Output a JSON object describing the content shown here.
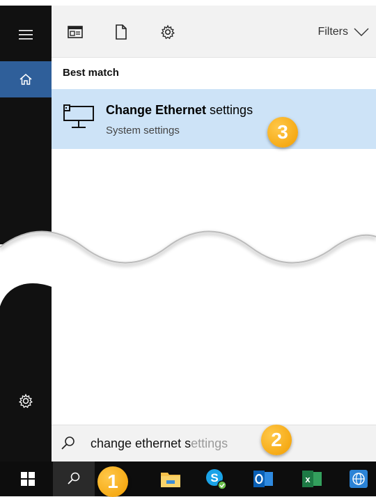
{
  "toolbar": {
    "filters_label": "Filters"
  },
  "results": {
    "section_title": "Best match",
    "best_match": {
      "title_bold": "Change Ethernet",
      "title_rest": " settings",
      "subtitle": "System settings"
    }
  },
  "search": {
    "typed": "change ethernet s",
    "suggestion": "ettings"
  },
  "callouts": {
    "one": "1",
    "two": "2",
    "three": "3"
  },
  "colors": {
    "rail": "#111111",
    "accent_home": "#2f5f9a",
    "highlight": "#cde3f7",
    "callout": "#f4a300"
  },
  "icons": {
    "rail": [
      "hamburger-menu-icon",
      "home-icon",
      "settings-gear-icon"
    ],
    "toolbar": [
      "apps-icon",
      "documents-icon",
      "settings-icon",
      "chevron-down-icon"
    ],
    "result": "ethernet-network-icon",
    "taskbar": [
      "windows-start-icon",
      "search-icon",
      "file-explorer-icon",
      "skype-icon",
      "outlook-icon",
      "excel-icon",
      "browser-icon"
    ]
  }
}
